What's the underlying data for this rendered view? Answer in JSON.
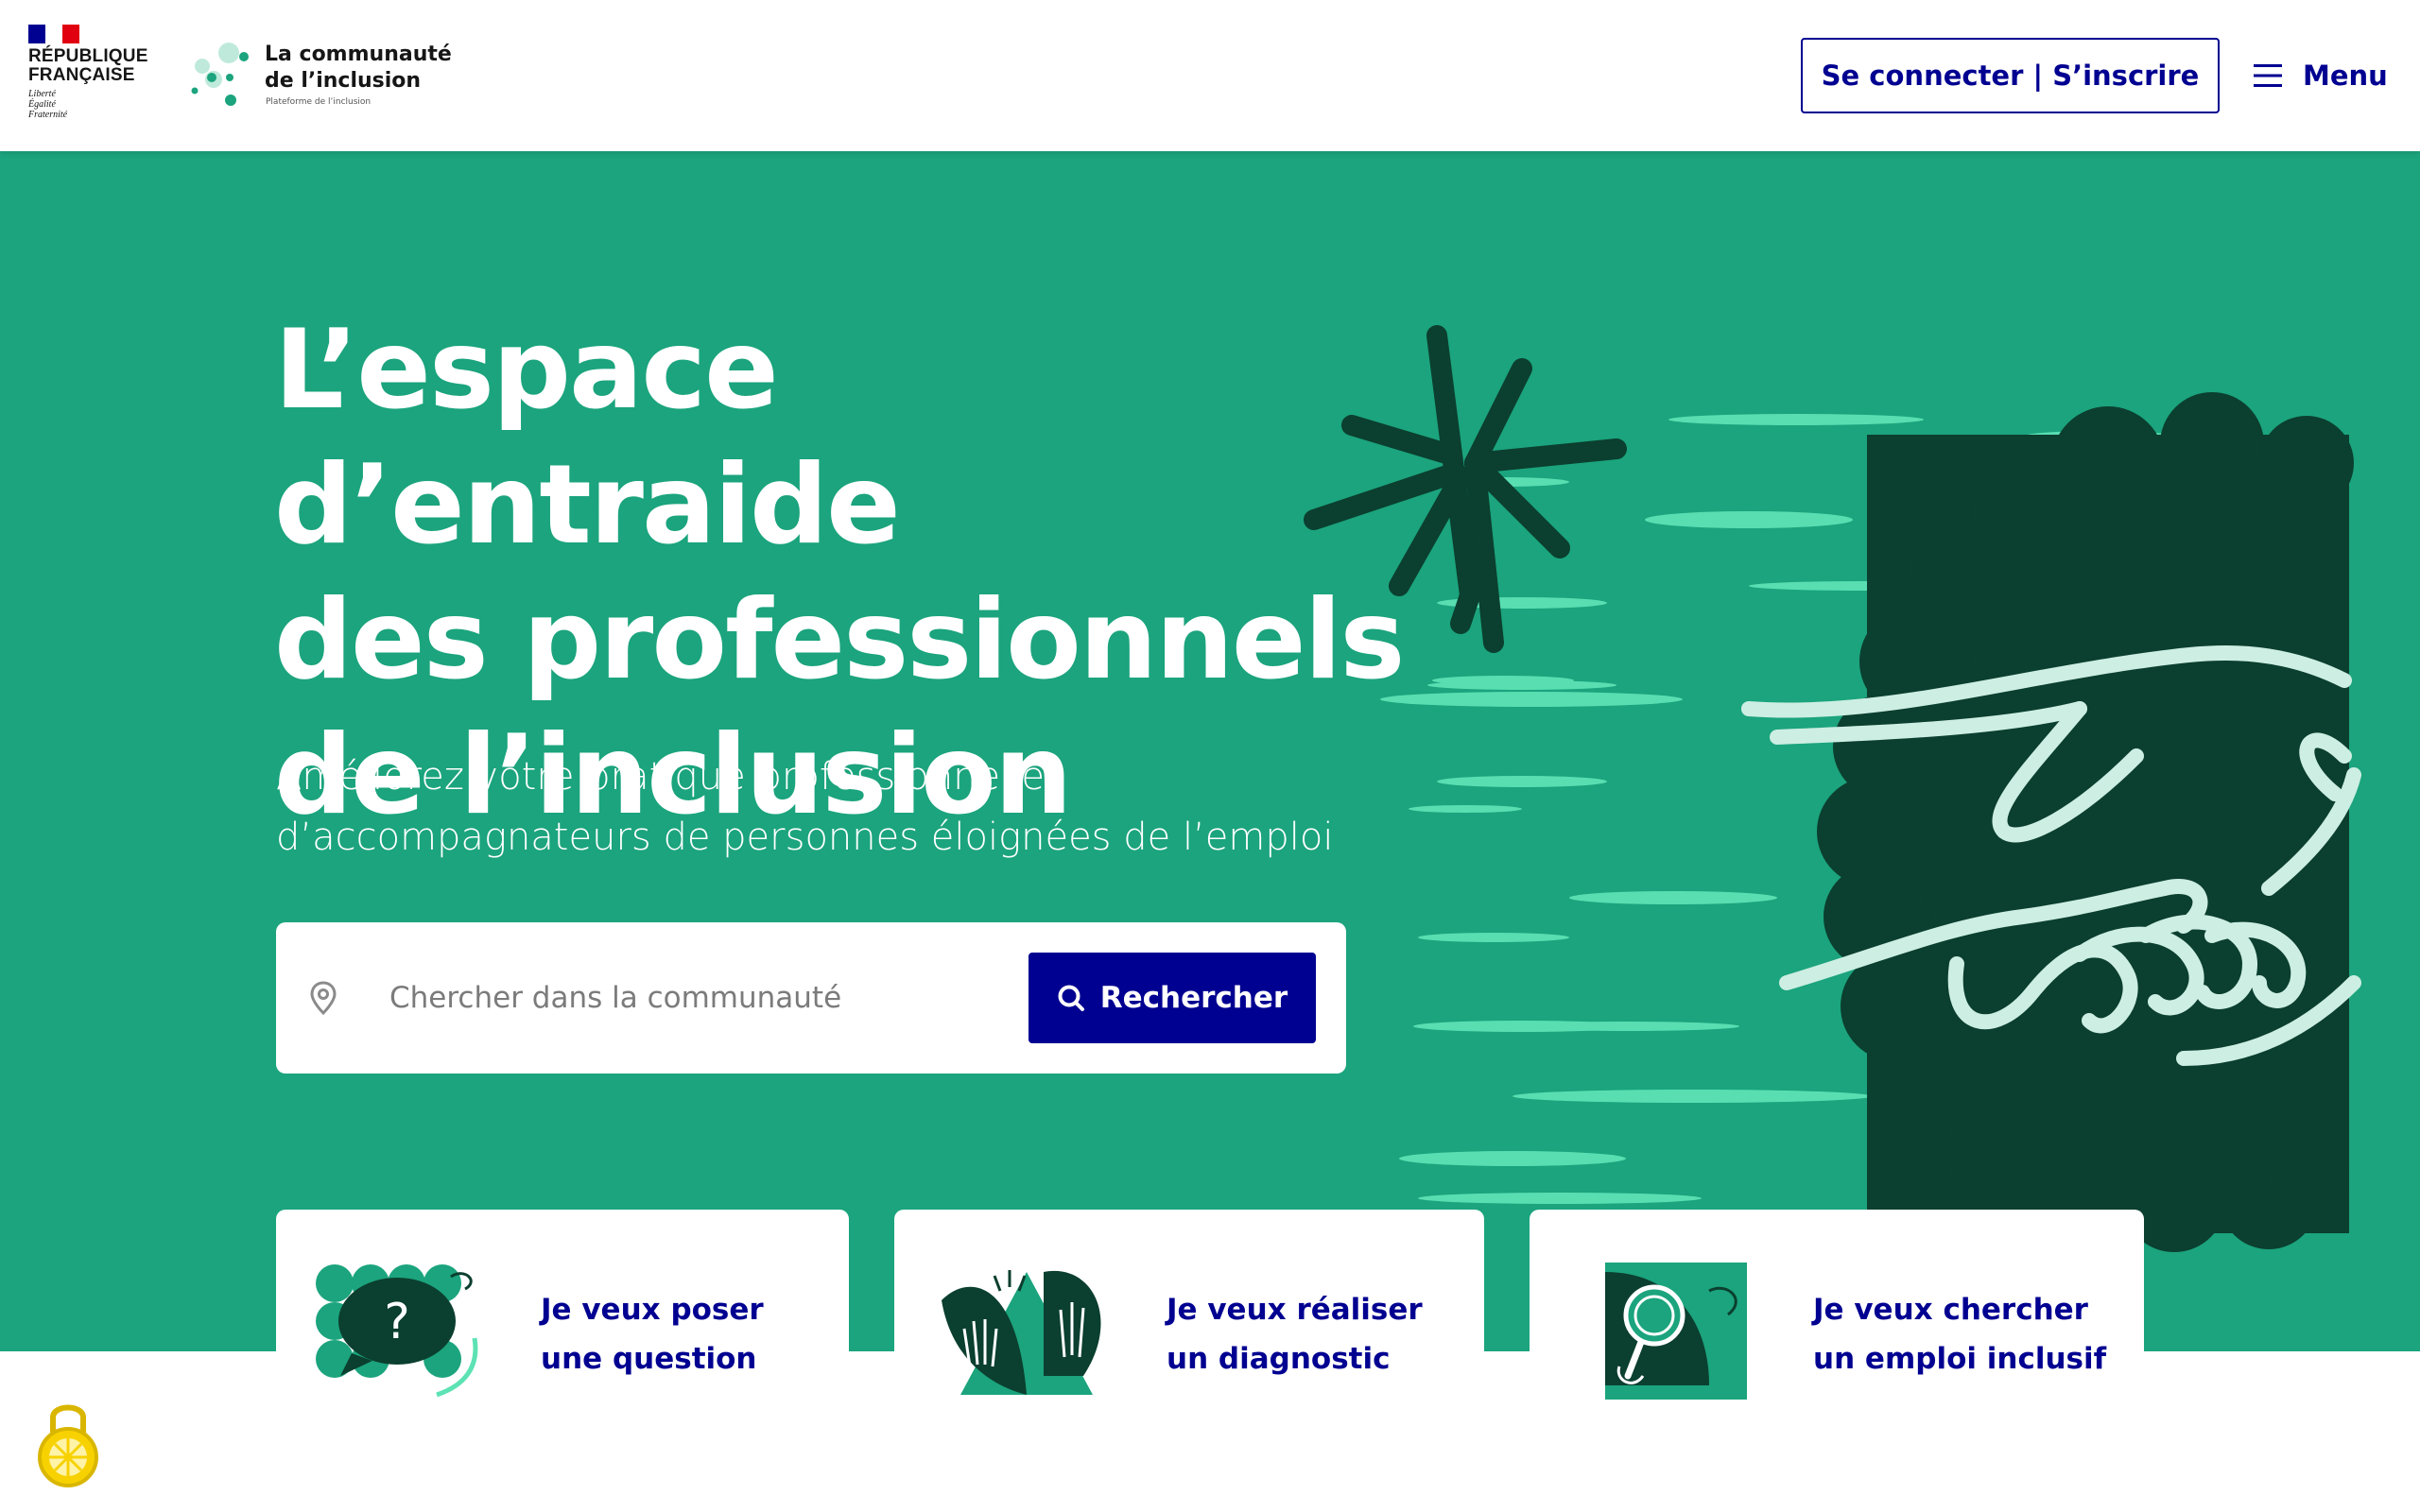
{
  "header": {
    "republic": "RÉPUBLIQUE\nFRANÇAISE",
    "motto": "Liberté\nÉgalité\nFraternité",
    "brand_name": "La communauté\nde l’inclusion",
    "brand_tagline": "Plateforme de l’inclusion",
    "login_label": "Se connecter | S’inscrire",
    "menu_label": "Menu"
  },
  "hero": {
    "title": "L’espace d’entraide\ndes professionnels\nde l’inclusion",
    "subtitle": "Améliorez votre pratique professionnelle\nd’accompagnateurs de personnes éloignées de l’emploi",
    "search_placeholder": "Chercher dans la communauté",
    "search_button": "Rechercher"
  },
  "cards": [
    {
      "label": "Je veux poser\nune question",
      "icon": "question-bubble-icon"
    },
    {
      "label": "Je veux réaliser\nun diagnostic",
      "icon": "raised-hands-icon"
    },
    {
      "label": "Je veux chercher\nun emploi inclusif",
      "icon": "magnifier-icon"
    }
  ],
  "colors": {
    "hero_green": "#1ba47d",
    "dark_green": "#0b3f2f",
    "mint": "#5de2b4",
    "blue_france": "#000091"
  }
}
